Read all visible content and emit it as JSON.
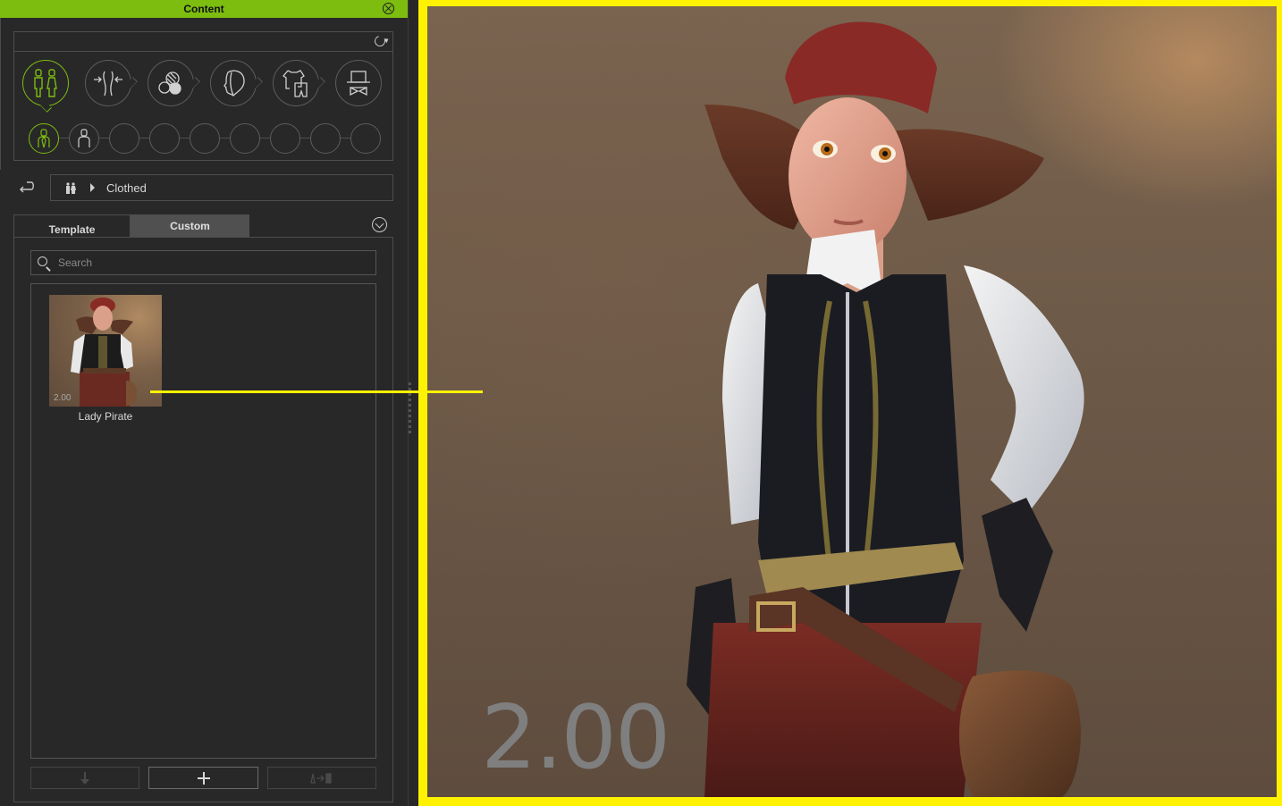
{
  "panel": {
    "title": "Content",
    "close_icon": "close-circle-icon",
    "refresh_icon": "refresh-icon"
  },
  "categories": {
    "main": [
      {
        "name": "actor-type",
        "icon": "two-figures-icon",
        "active": true
      },
      {
        "name": "morph",
        "icon": "morph-arrows-icon",
        "active": false
      },
      {
        "name": "skin",
        "icon": "skin-spheres-icon",
        "active": false
      },
      {
        "name": "head",
        "icon": "head-profile-icon",
        "active": false
      },
      {
        "name": "clothing",
        "icon": "clothes-icon",
        "active": false
      },
      {
        "name": "accessory",
        "icon": "hat-bowtie-icon",
        "active": false
      }
    ],
    "sub": [
      {
        "name": "clothed",
        "icon": "clothed-figure-icon",
        "active": true
      },
      {
        "name": "naked",
        "icon": "naked-figure-icon",
        "active": false
      },
      {
        "name": "empty-3"
      },
      {
        "name": "empty-4"
      },
      {
        "name": "empty-5"
      },
      {
        "name": "empty-6"
      },
      {
        "name": "empty-7"
      },
      {
        "name": "empty-8"
      },
      {
        "name": "empty-9"
      }
    ]
  },
  "breadcrumb": {
    "back_icon": "return-arrow-icon",
    "root_icon": "two-figures-icon",
    "current": "Clothed"
  },
  "tabs": [
    {
      "label": "Template",
      "active": false
    },
    {
      "label": "Custom",
      "active": true
    }
  ],
  "search": {
    "placeholder": "Search",
    "value": ""
  },
  "items": [
    {
      "label": "Lady Pirate",
      "version": "2.00"
    }
  ],
  "bottom_buttons": [
    {
      "name": "download",
      "icon": "down-arrow-icon",
      "enabled": false
    },
    {
      "name": "add",
      "icon": "plus-icon",
      "enabled": true
    },
    {
      "name": "apply-to-item",
      "icon": "apply-transfer-icon",
      "enabled": false
    }
  ],
  "viewport": {
    "version_overlay": "2.00",
    "highlight_color": "#fff200",
    "accent_color": "#7cbd10"
  }
}
